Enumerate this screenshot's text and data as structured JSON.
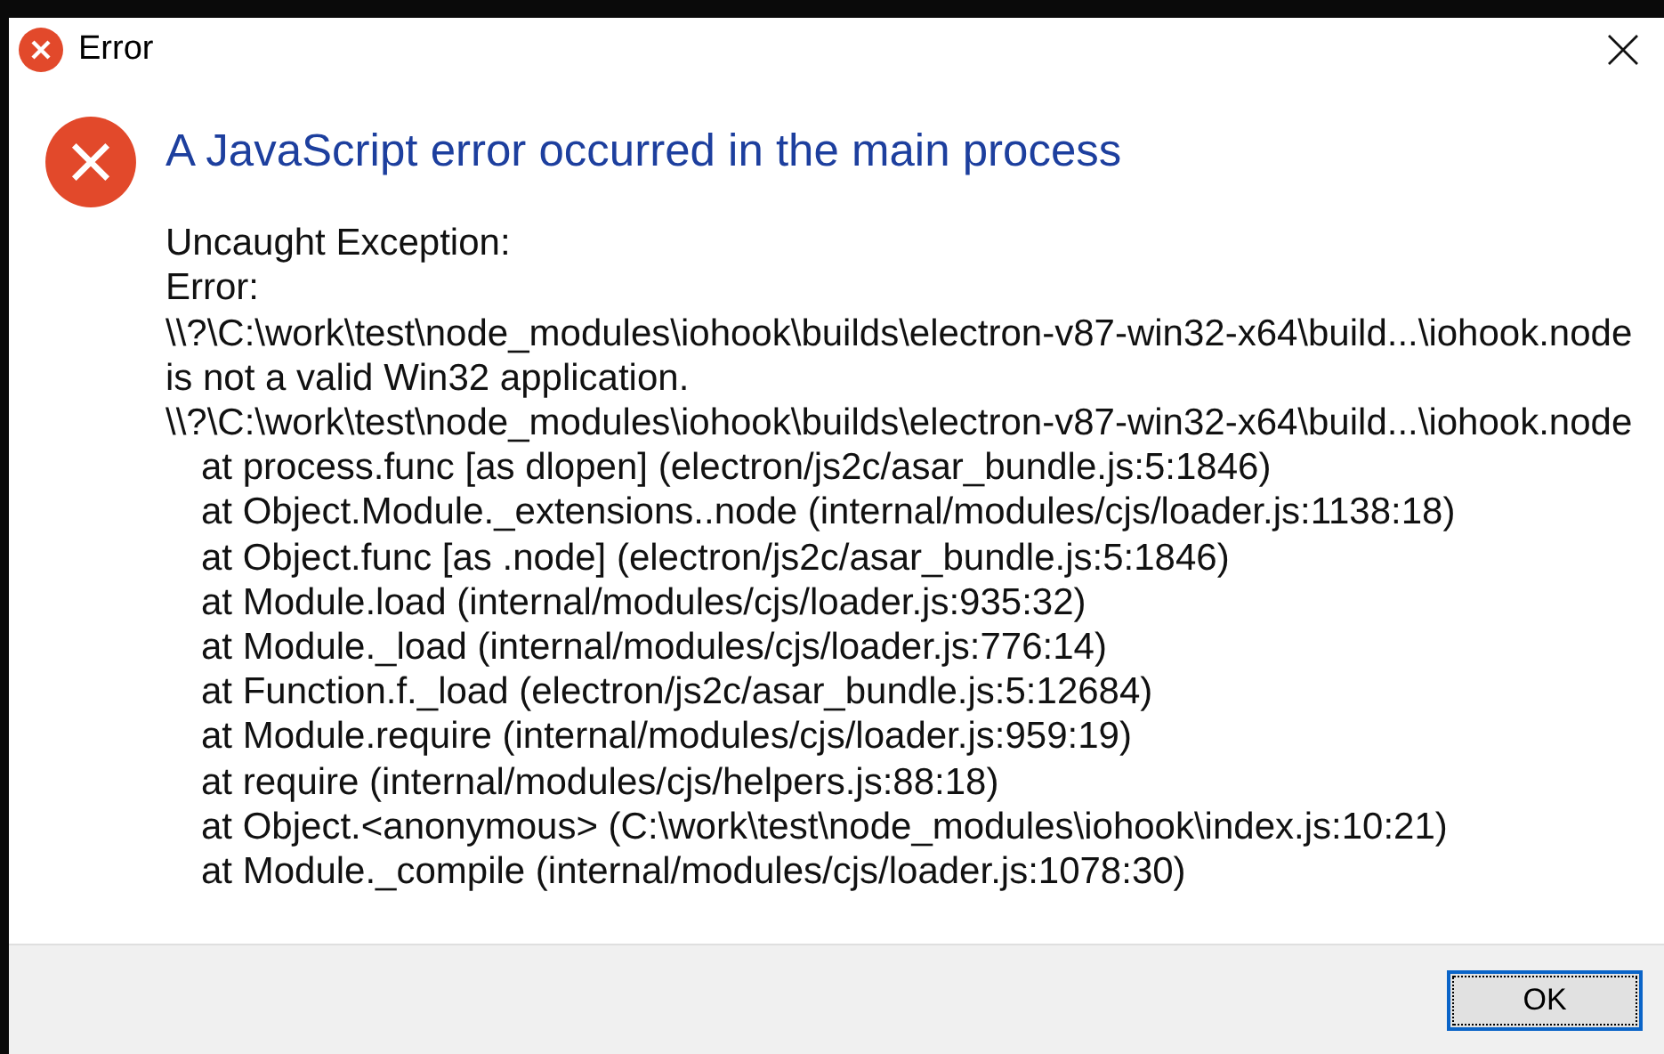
{
  "window": {
    "title": "Error"
  },
  "heading": "A JavaScript error occurred in the main process",
  "message_lines": [
    {
      "text": "Uncaught Exception:",
      "indented": false
    },
    {
      "text": "Error:",
      "indented": false
    },
    {
      "text": "\\\\?\\C:\\work\\test\\node_modules\\iohook\\builds\\electron-v87-win32-x64\\build...\\iohook.node",
      "indented": false
    },
    {
      "text": "is not a valid Win32 application.",
      "indented": false
    },
    {
      "text": "\\\\?\\C:\\work\\test\\node_modules\\iohook\\builds\\electron-v87-win32-x64\\build...\\iohook.node",
      "indented": false
    },
    {
      "text": "at process.func [as dlopen] (electron/js2c/asar_bundle.js:5:1846)",
      "indented": true
    },
    {
      "text": "at Object.Module._extensions..node (internal/modules/cjs/loader.js:1138:18)",
      "indented": true
    },
    {
      "text": "at Object.func [as .node] (electron/js2c/asar_bundle.js:5:1846)",
      "indented": true
    },
    {
      "text": "at Module.load (internal/modules/cjs/loader.js:935:32)",
      "indented": true
    },
    {
      "text": "at Module._load (internal/modules/cjs/loader.js:776:14)",
      "indented": true
    },
    {
      "text": "at Function.f._load (electron/js2c/asar_bundle.js:5:12684)",
      "indented": true
    },
    {
      "text": "at Module.require (internal/modules/cjs/loader.js:959:19)",
      "indented": true
    },
    {
      "text": "at require (internal/modules/cjs/helpers.js:88:18)",
      "indented": true
    },
    {
      "text": "at Object.<anonymous> (C:\\work\\test\\node_modules\\iohook\\index.js:10:21)",
      "indented": true
    },
    {
      "text": "at Module._compile (internal/modules/cjs/loader.js:1078:30)",
      "indented": true
    }
  ],
  "buttons": [
    {
      "label": "OK",
      "focused": true
    }
  ]
}
